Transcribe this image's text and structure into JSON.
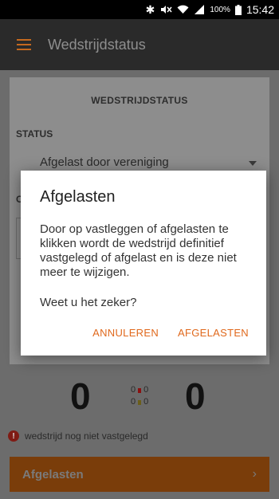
{
  "status_bar": {
    "battery": "100%",
    "time": "15:42"
  },
  "appbar": {
    "title": "Wedstrijdstatus"
  },
  "form": {
    "section_title": "WEDSTRIJDSTATUS",
    "status_label": "STATUS",
    "status_value": "Afgelast door vereniging",
    "second_label": "C"
  },
  "score": {
    "home": "0",
    "away": "0",
    "red_cards": "0",
    "yellow_cards": "0"
  },
  "warning": {
    "text": "wedstrijd nog niet vastgelegd"
  },
  "bottom_button": {
    "label": "Afgelasten",
    "chevron": "›"
  },
  "dialog": {
    "title": "Afgelasten",
    "body": "Door op vastleggen of afgelasten te klikken wordt de wedstrijd definitief vastgelegd of afgelast en is deze niet meer te wijzigen.",
    "question": "Weet u het zeker?",
    "cancel_label": "ANNULEREN",
    "confirm_label": "AFGELASTEN"
  },
  "colors": {
    "accent": "#E0691D",
    "appbar": "#2A2A2A",
    "dimmed_button": "#7A3D0A",
    "error": "#7F1B14"
  }
}
